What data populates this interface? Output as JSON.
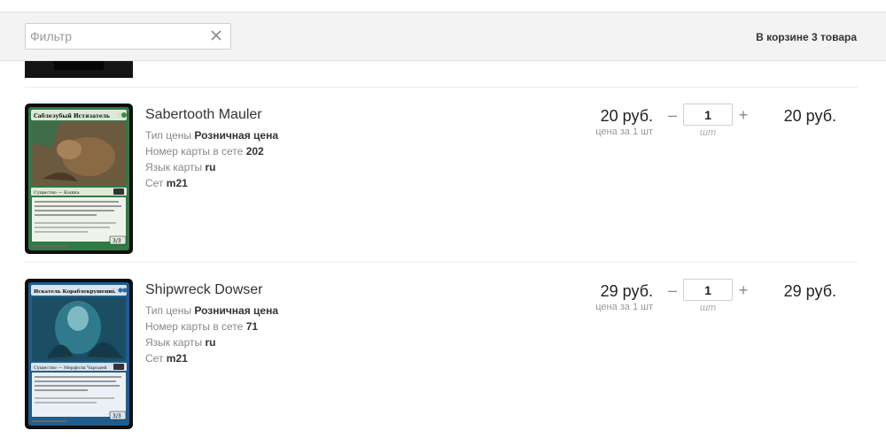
{
  "filter": {
    "placeholder": "Фильтр",
    "value": ""
  },
  "cart_summary": "В корзине 3 товара",
  "items": [
    {
      "name": "Sabertooth Mauler",
      "price_type_label": "Тип цены",
      "price_type": "Розничная цена",
      "card_number_label": "Номер карты в сете",
      "card_number": "202",
      "language_label": "Язык карты",
      "language": "ru",
      "set_label": "Сет",
      "set": "m21",
      "price": "20 руб.",
      "price_unit": "цена за 1 шт",
      "quantity": "1",
      "quantity_unit": "шт",
      "total": "20 руб.",
      "card_title": "Саблезубый Истязатель",
      "card_type": "Существо — Кошка",
      "card_pt": "3/3",
      "card_color": "#1e6b3a"
    },
    {
      "name": "Shipwreck Dowser",
      "price_type_label": "Тип цены",
      "price_type": "Розничная цена",
      "card_number_label": "Номер карты в сете",
      "card_number": "71",
      "language_label": "Язык карты",
      "language": "ru",
      "set_label": "Сет",
      "set": "m21",
      "price": "29 руб.",
      "price_unit": "цена за 1 шт",
      "quantity": "1",
      "quantity_unit": "шт",
      "total": "29 руб.",
      "card_title": "Искатель Кораблекрушений",
      "card_type": "Существо — Мерфолк Чародей",
      "card_pt": "3/3",
      "card_color": "#1a4f7a"
    }
  ],
  "qty_controls": {
    "minus": "–",
    "plus": "+"
  }
}
